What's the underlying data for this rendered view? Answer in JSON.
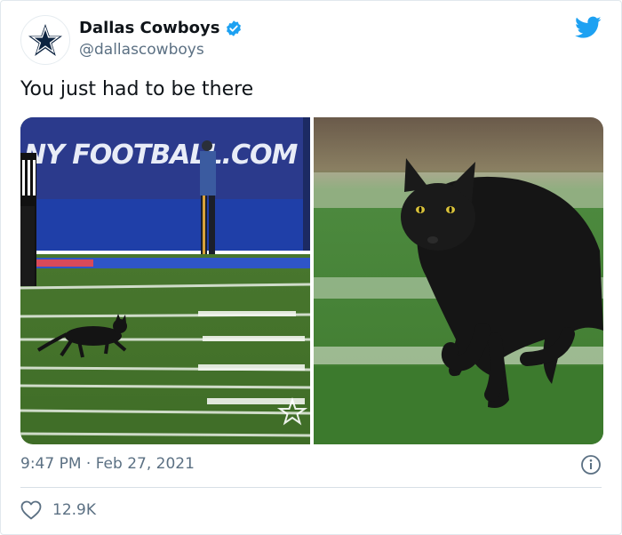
{
  "tweet": {
    "author": {
      "display_name": "Dallas Cowboys",
      "handle": "@dallascowboys",
      "verified": true,
      "avatar_icon": "star-logo-icon"
    },
    "text": "You just had to be there",
    "timestamp": "9:47 PM · Feb 27, 2021",
    "likes": "12.9K",
    "media": [
      {
        "kind": "photo",
        "banner_text": "NY FOOTBALL.COM"
      },
      {
        "kind": "photo"
      }
    ]
  },
  "colors": {
    "twitter_blue": "#1da1f2",
    "verified_blue": "#1da1f2",
    "muted_text": "#5b7083",
    "cowboys_navy": "#0c2340"
  },
  "icons": [
    "star-logo-icon",
    "verified-badge-icon",
    "twitter-bird-icon",
    "info-icon",
    "heart-icon"
  ]
}
